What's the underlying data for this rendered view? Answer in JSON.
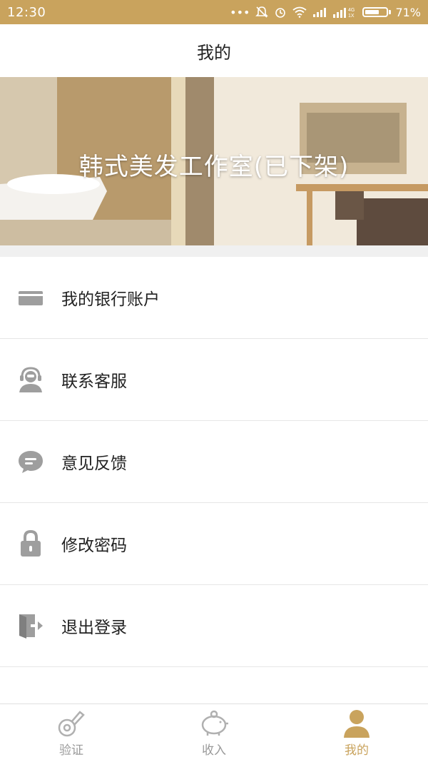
{
  "status_bar": {
    "time": "12:30",
    "network": "4G\n1X",
    "battery_percent_label": "71%",
    "battery_level": 0.71
  },
  "header": {
    "title": "我的"
  },
  "banner": {
    "shop_name": "韩式美发工作室(已下架)"
  },
  "menu": {
    "items": [
      {
        "label": "我的银行账户",
        "icon": "bank-card-icon"
      },
      {
        "label": "联系客服",
        "icon": "customer-service-icon"
      },
      {
        "label": "意见反馈",
        "icon": "feedback-chat-icon"
      },
      {
        "label": "修改密码",
        "icon": "lock-icon"
      },
      {
        "label": "退出登录",
        "icon": "logout-icon"
      }
    ]
  },
  "bottom_nav": {
    "items": [
      {
        "label": "验证",
        "icon": "guitar-pick-verify-icon",
        "active": false
      },
      {
        "label": "收入",
        "icon": "piggy-bank-icon",
        "active": false
      },
      {
        "label": "我的",
        "icon": "user-profile-icon",
        "active": true
      }
    ]
  },
  "colors": {
    "accent": "#c9a35d",
    "icon_gray": "#9e9e9e",
    "divider": "#e6e6e6"
  }
}
